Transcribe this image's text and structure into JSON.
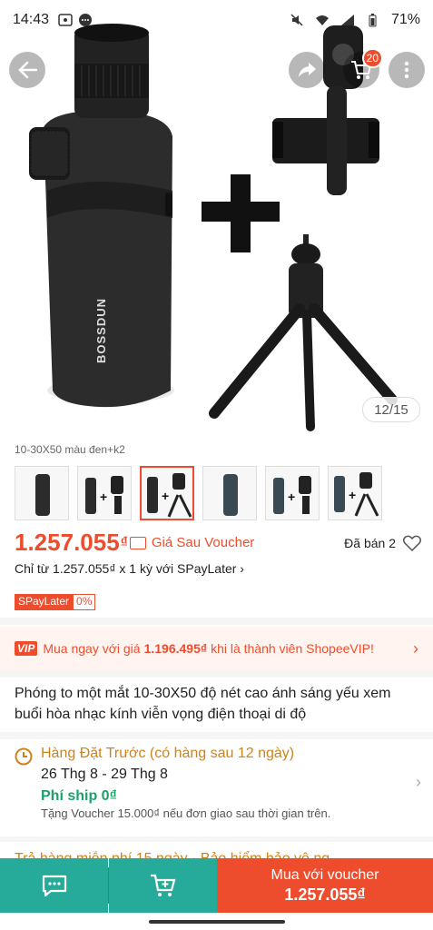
{
  "status": {
    "time": "14:43",
    "battery": "71%"
  },
  "hero": {
    "counter": "12/15",
    "brand_text": "BOSSDUN",
    "cart_badge": "20",
    "plus_sign": "+"
  },
  "variants": {
    "caption": "10-30X50 màu đen+k2",
    "items": [
      "v1",
      "v2",
      "v3",
      "v4",
      "v5",
      "v6"
    ]
  },
  "price": {
    "amount": "1.257.055",
    "currency": "₫",
    "voucher_label": "Giá Sau Voucher",
    "sold": "Đã bán 2"
  },
  "installment": "Chỉ từ 1.257.055₫ x 1 kỳ với SPayLater ›",
  "spaylater": {
    "tag": "SPayLater",
    "rate": "0%"
  },
  "vip": {
    "badge": "VIP",
    "prefix": "Mua ngay với giá",
    "price": "1.196.495₫",
    "suffix": "khi là thành viên ShopeeVIP!"
  },
  "product_title": "Phóng to một mắt 10-30X50 độ nét cao ánh sáng yếu xem buổi hòa nhạc kính viễn vọng điện thoại di độ",
  "shipping": {
    "status": "Hàng Đặt Trước (có hàng sau 12 ngày)",
    "dates": "26 Thg 8 - 29 Thg 8",
    "fee": "Phí ship 0₫",
    "voucher": "Tặng Voucher 15.000₫ nếu đơn giao sau thời gian trên."
  },
  "guarantee": "Trả hàng miễn phí 15 ngày · Bảo hiểm bảo vệ ng",
  "bottom": {
    "buy_label": "Mua với voucher",
    "buy_price": "1.257.055₫"
  },
  "colors": {
    "accent": "#ee4d2d",
    "teal": "#26aa99",
    "green": "#1fa06a",
    "amber": "#d0821a"
  }
}
